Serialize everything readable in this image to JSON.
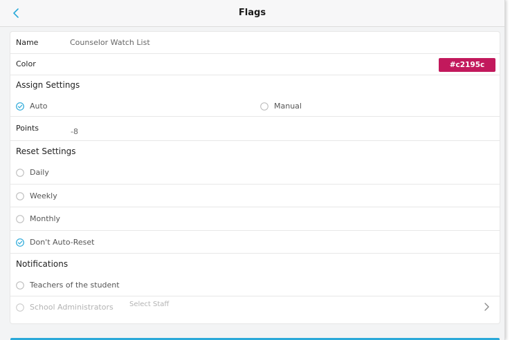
{
  "header": {
    "title": "Flags"
  },
  "form": {
    "name_label": "Name",
    "name_value": "Counselor Watch List",
    "color_label": "Color",
    "color_value": "#c2195c",
    "assign_settings_heading": "Assign Settings",
    "assign_options": [
      {
        "label": "Auto",
        "selected": true
      },
      {
        "label": "Manual",
        "selected": false
      }
    ],
    "points_label": "Points",
    "points_value": "-8",
    "reset_settings_heading": "Reset Settings",
    "reset_options": [
      {
        "label": "Daily",
        "selected": false
      },
      {
        "label": "Weekly",
        "selected": false
      },
      {
        "label": "Monthly",
        "selected": false
      },
      {
        "label": "Don't Auto-Reset",
        "selected": true
      }
    ],
    "notifications_heading": "Notifications",
    "notification_options": [
      {
        "label": "Teachers of the student",
        "selected": false,
        "disabled": false
      },
      {
        "label": "School Administrators",
        "selected": false,
        "disabled": true
      }
    ],
    "select_staff_label": "Select Staff"
  },
  "colors": {
    "accent": "#2aa9d9",
    "flag_color": "#c2195c",
    "bottom_bar": "#2aa9d9"
  },
  "icons": {
    "back": "chevron-left-icon",
    "checked": "check-circle-icon",
    "unchecked": "empty-circle-icon",
    "staff_chevron": "chevron-right-icon"
  }
}
